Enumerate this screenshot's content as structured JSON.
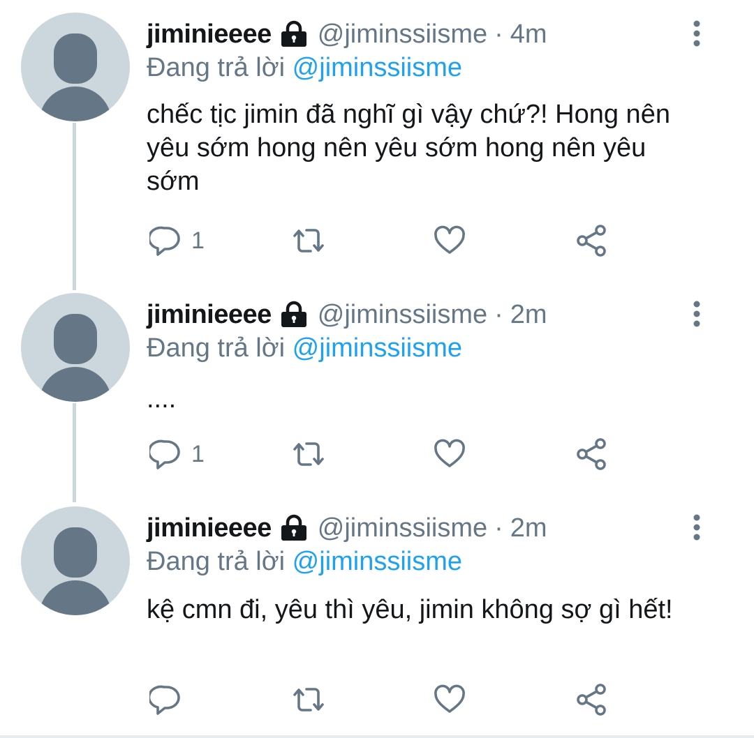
{
  "tweets": [
    {
      "display_name": "jiminieeee",
      "handle": "@jiminssiisme",
      "separator": "·",
      "time": "4m",
      "reply_prefix": "Đang trả lời",
      "reply_to": "@jiminssiisme",
      "text": "chếc tịc jimin đã nghĩ gì vậy chứ?! Hong nên yêu sớm hong nên yêu sớm hong nên yêu sớm",
      "reply_count": "1"
    },
    {
      "display_name": "jiminieeee",
      "handle": "@jiminssiisme",
      "separator": "·",
      "time": "2m",
      "reply_prefix": "Đang trả lời",
      "reply_to": "@jiminssiisme",
      "text": "....",
      "reply_count": "1"
    },
    {
      "display_name": "jiminieeee",
      "handle": "@jiminssiisme",
      "separator": "·",
      "time": "2m",
      "reply_prefix": "Đang trả lời",
      "reply_to": "@jiminssiisme",
      "text": "kệ cmn đi, yêu thì yêu, jimin không sợ gì hết!",
      "reply_count": ""
    }
  ],
  "icons": {
    "lock": "lock-icon",
    "more": "more-vertical-icon",
    "reply": "reply-bubble-icon",
    "retweet": "retweet-icon",
    "like": "heart-icon",
    "share": "share-icon"
  },
  "colors": {
    "name": "#14171a",
    "muted": "#657786",
    "mention": "#1da1f2",
    "avatar_bg": "#ccd6dd",
    "avatar_fg": "#657786",
    "thread_line": "#ccd6dd"
  }
}
